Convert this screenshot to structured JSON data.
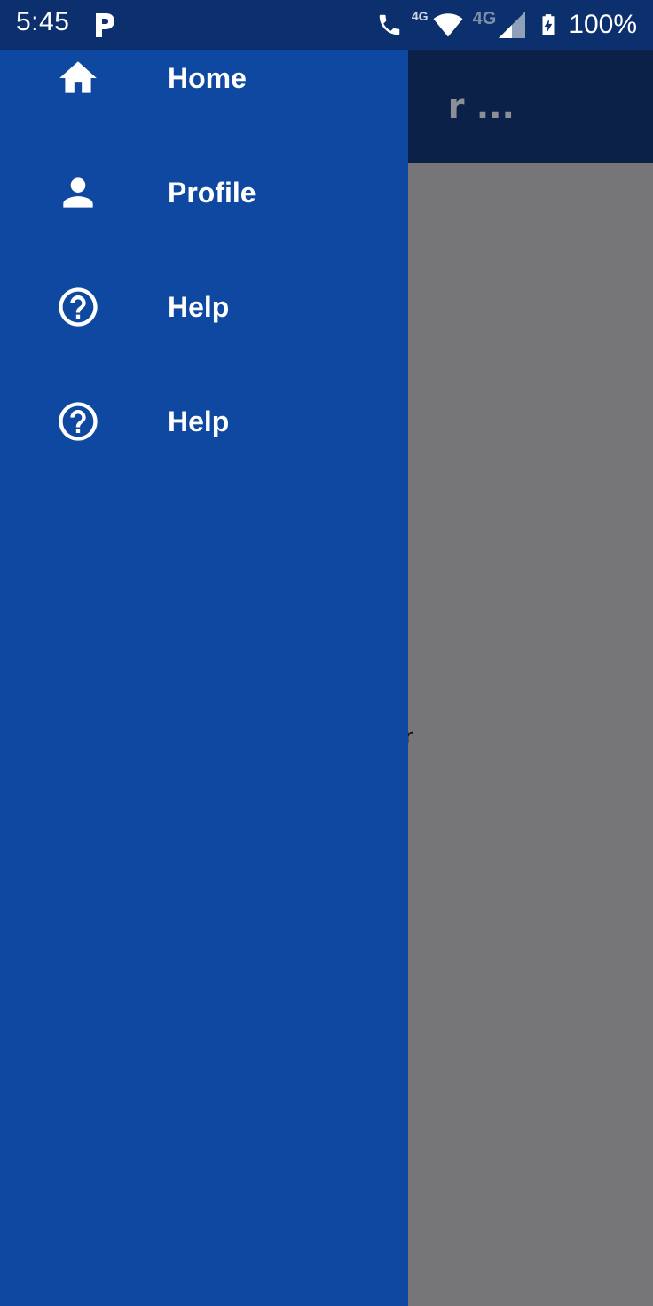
{
  "status_bar": {
    "time": "5:45",
    "notification_icon": "parking-p-icon",
    "call_label": "4G",
    "network_label": "4G",
    "battery": "100%"
  },
  "background_app": {
    "title_fragment": "r ...",
    "content_fragment": "n"
  },
  "drawer": {
    "items": [
      {
        "label": "Home",
        "icon": "home-icon"
      },
      {
        "label": "Profile",
        "icon": "person-icon"
      },
      {
        "label": "Help",
        "icon": "help-circle-icon"
      },
      {
        "label": "Help",
        "icon": "help-circle-icon"
      }
    ]
  },
  "colors": {
    "drawer": "#0e48a0",
    "status_bar": "#0c2f6e",
    "scrim": "#767678",
    "text": "#ffffff"
  }
}
